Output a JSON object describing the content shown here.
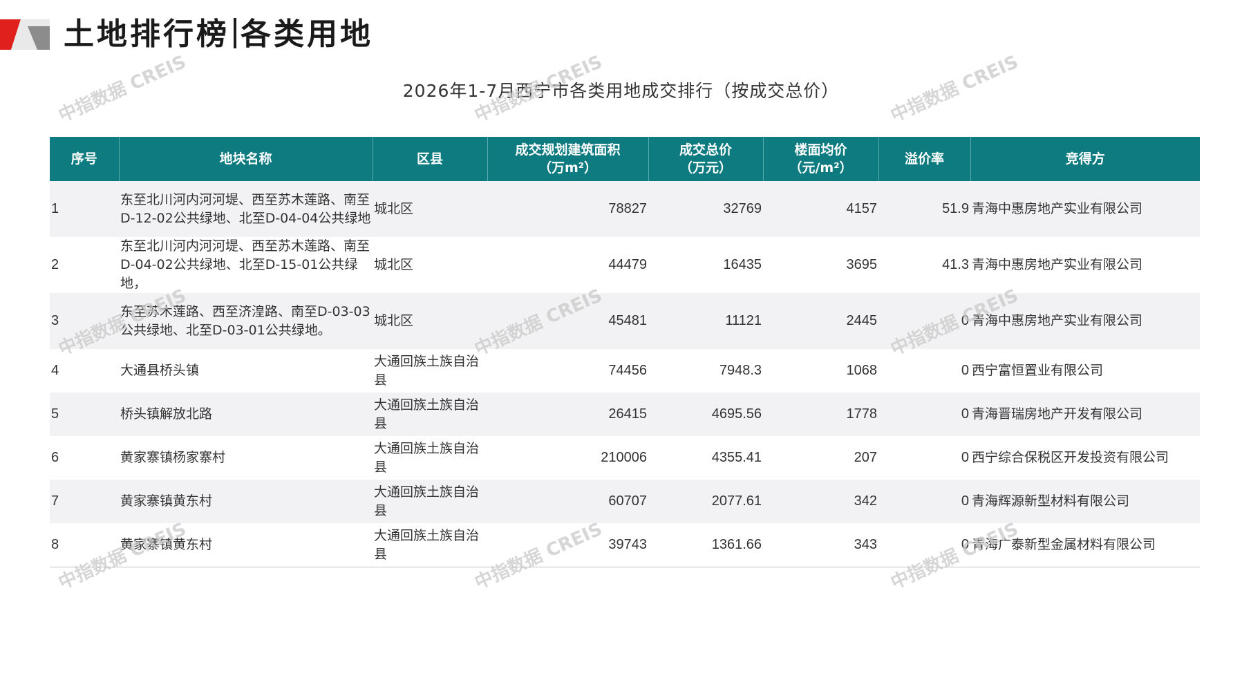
{
  "header": {
    "title_part1": "土地排行榜",
    "title_part2": "各类用地"
  },
  "brand_colors": {
    "accent_red": "#e0201c",
    "accent_gray": "#8c8c8c",
    "table_header": "#0e7b80",
    "price_red": "#c0171d"
  },
  "report_title": "2026年1-7月西宁市各类用地成交排行（按成交总价）",
  "watermark_text": "中指数据 CREIS",
  "table": {
    "columns": [
      "序号",
      "地块名称",
      "区县",
      "成交规划建筑面积\n（万m²）",
      "成交总价\n（万元）",
      "楼面均价\n（元/m²）",
      "溢价率",
      "竞得方"
    ],
    "rows": [
      {
        "rank": "1",
        "name": "东至北川河内河河堤、西至苏木莲路、南至D-12-02公共绿地、北至D-04-04公共绿地",
        "district": "城北区",
        "area": "78827",
        "total_price": "32769",
        "floor_price": "4157",
        "premium": "51.9",
        "buyer": "青海中惠房地产实业有限公司"
      },
      {
        "rank": "2",
        "name": "东至北川河内河河堤、西至苏木莲路、南至D-04-02公共绿地、北至D-15-01公共绿地，",
        "district": "城北区",
        "area": "44479",
        "total_price": "16435",
        "floor_price": "3695",
        "premium": "41.3",
        "buyer": "青海中惠房地产实业有限公司"
      },
      {
        "rank": "3",
        "name": "东至苏木莲路、西至济湟路、南至D-03-03公共绿地、北至D-03-01公共绿地。",
        "district": "城北区",
        "area": "45481",
        "total_price": "11121",
        "floor_price": "2445",
        "premium": "0",
        "buyer": "青海中惠房地产实业有限公司"
      },
      {
        "rank": "4",
        "name": "大通县桥头镇",
        "district": "大通回族土族自治县",
        "area": "74456",
        "total_price": "7948.3",
        "floor_price": "1068",
        "premium": "0",
        "buyer": "西宁富恒置业有限公司"
      },
      {
        "rank": "5",
        "name": "桥头镇解放北路",
        "district": "大通回族土族自治县",
        "area": "26415",
        "total_price": "4695.56",
        "floor_price": "1778",
        "premium": "0",
        "buyer": "青海晋瑞房地产开发有限公司"
      },
      {
        "rank": "6",
        "name": "黄家寨镇杨家寨村",
        "district": "大通回族土族自治县",
        "area": "210006",
        "total_price": "4355.41",
        "floor_price": "207",
        "premium": "0",
        "buyer": "西宁综合保税区开发投资有限公司"
      },
      {
        "rank": "7",
        "name": "黄家寨镇黄东村",
        "district": "大通回族土族自治县",
        "area": "60707",
        "total_price": "2077.61",
        "floor_price": "342",
        "premium": "0",
        "buyer": "青海辉源新型材料有限公司"
      },
      {
        "rank": "8",
        "name": "黄家寨镇黄东村",
        "district": "大通回族土族自治县",
        "area": "39743",
        "total_price": "1361.66",
        "floor_price": "343",
        "premium": "0",
        "buyer": "青海广泰新型金属材料有限公司"
      }
    ]
  }
}
